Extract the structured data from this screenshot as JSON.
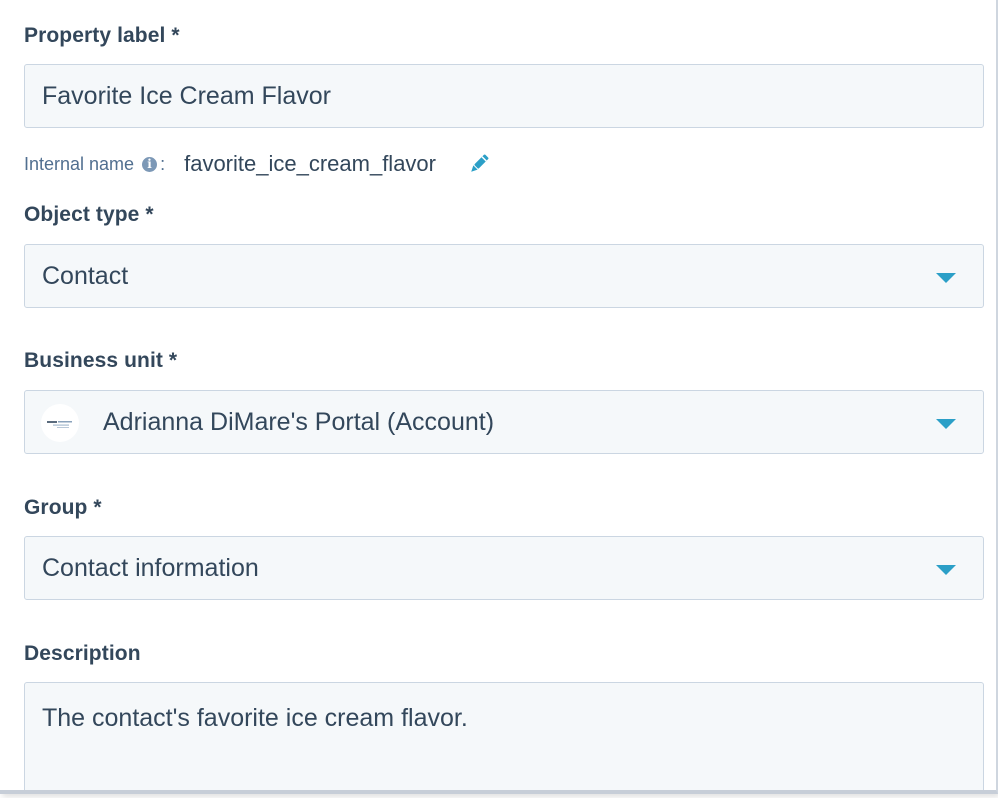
{
  "property_label": {
    "label": "Property label *",
    "value": "Favorite Ice Cream Flavor"
  },
  "internal_name": {
    "label": "Internal name",
    "colon": ":",
    "value": "favorite_ice_cream_flavor",
    "info_icon": "info-icon",
    "edit_icon": "pencil-icon"
  },
  "object_type": {
    "label": "Object type *",
    "value": "Contact"
  },
  "business_unit": {
    "label": "Business unit *",
    "value": "Adrianna DiMare's Portal (Account)"
  },
  "group": {
    "label": "Group *",
    "value": "Contact information"
  },
  "description": {
    "label": "Description",
    "value": "The contact's favorite ice cream flavor."
  },
  "colors": {
    "label_text": "#33475b",
    "muted_text": "#516f90",
    "field_bg": "#f5f8fa",
    "field_border": "#cbd6e2",
    "accent": "#2b9fc7"
  }
}
